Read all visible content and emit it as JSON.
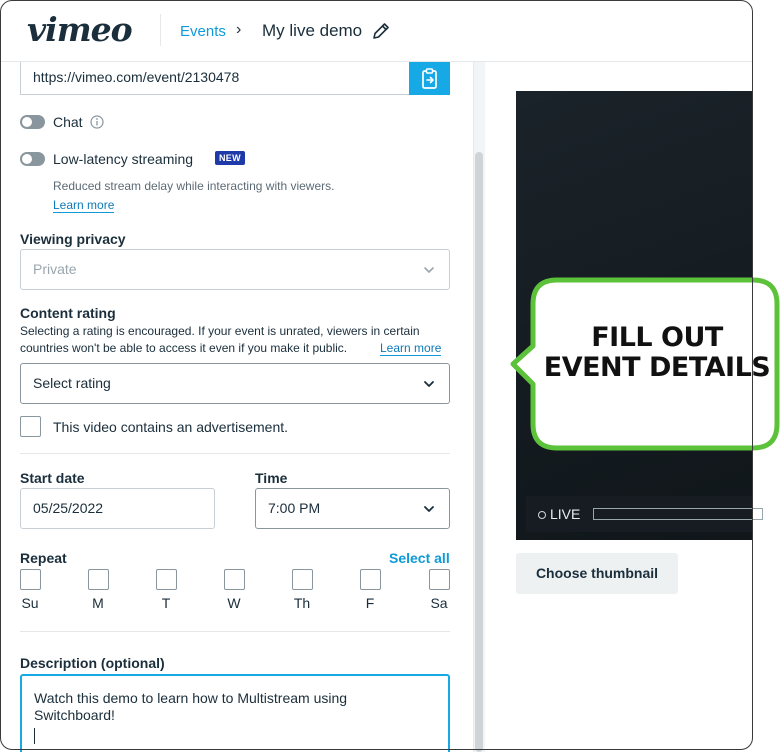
{
  "header": {
    "logo": "vimeo",
    "breadcrumb_link": "Events",
    "breadcrumb_separator": "›",
    "title": "My live demo",
    "edit_icon": "pencil-icon"
  },
  "event_link": {
    "url": "https://vimeo.com/event/2130478",
    "copy_icon": "clipboard-icon"
  },
  "chat": {
    "label": "Chat",
    "enabled": false,
    "info_icon": "info-icon"
  },
  "low_latency": {
    "label": "Low-latency streaming",
    "badge": "NEW",
    "enabled": false,
    "description": "Reduced stream delay while interacting with viewers.",
    "learn_more": "Learn more"
  },
  "viewing_privacy": {
    "label": "Viewing privacy",
    "value": "Private"
  },
  "content_rating": {
    "label": "Content rating",
    "description_line1": "Selecting a rating is encouraged. If your event is unrated, viewers in certain",
    "description_line2": "countries won't be able to access it even if you make it public.",
    "learn_more": "Learn more",
    "value": "Select rating"
  },
  "advertisement": {
    "label": "This video contains an advertisement.",
    "checked": false
  },
  "start_date": {
    "label": "Start date",
    "value": "05/25/2022"
  },
  "time": {
    "label": "Time",
    "value": "7:00 PM"
  },
  "repeat": {
    "label": "Repeat",
    "select_all": "Select all",
    "days": [
      "Su",
      "M",
      "T",
      "W",
      "Th",
      "F",
      "Sa"
    ]
  },
  "description": {
    "label": "Description (optional)",
    "line1": "Watch this demo to learn how to Multistream using",
    "line2": "Switchboard!"
  },
  "preview": {
    "live_label": "LIVE",
    "choose_thumbnail": "Choose thumbnail"
  },
  "callout": {
    "line1": "FILL OUT",
    "line2": "EVENT DETAILS",
    "border_color": "#5cc23a"
  },
  "colors": {
    "accent": "#17a9e5",
    "link": "#0e9bd8",
    "badge": "#1e3aa8",
    "text": "#1a2e3b"
  }
}
